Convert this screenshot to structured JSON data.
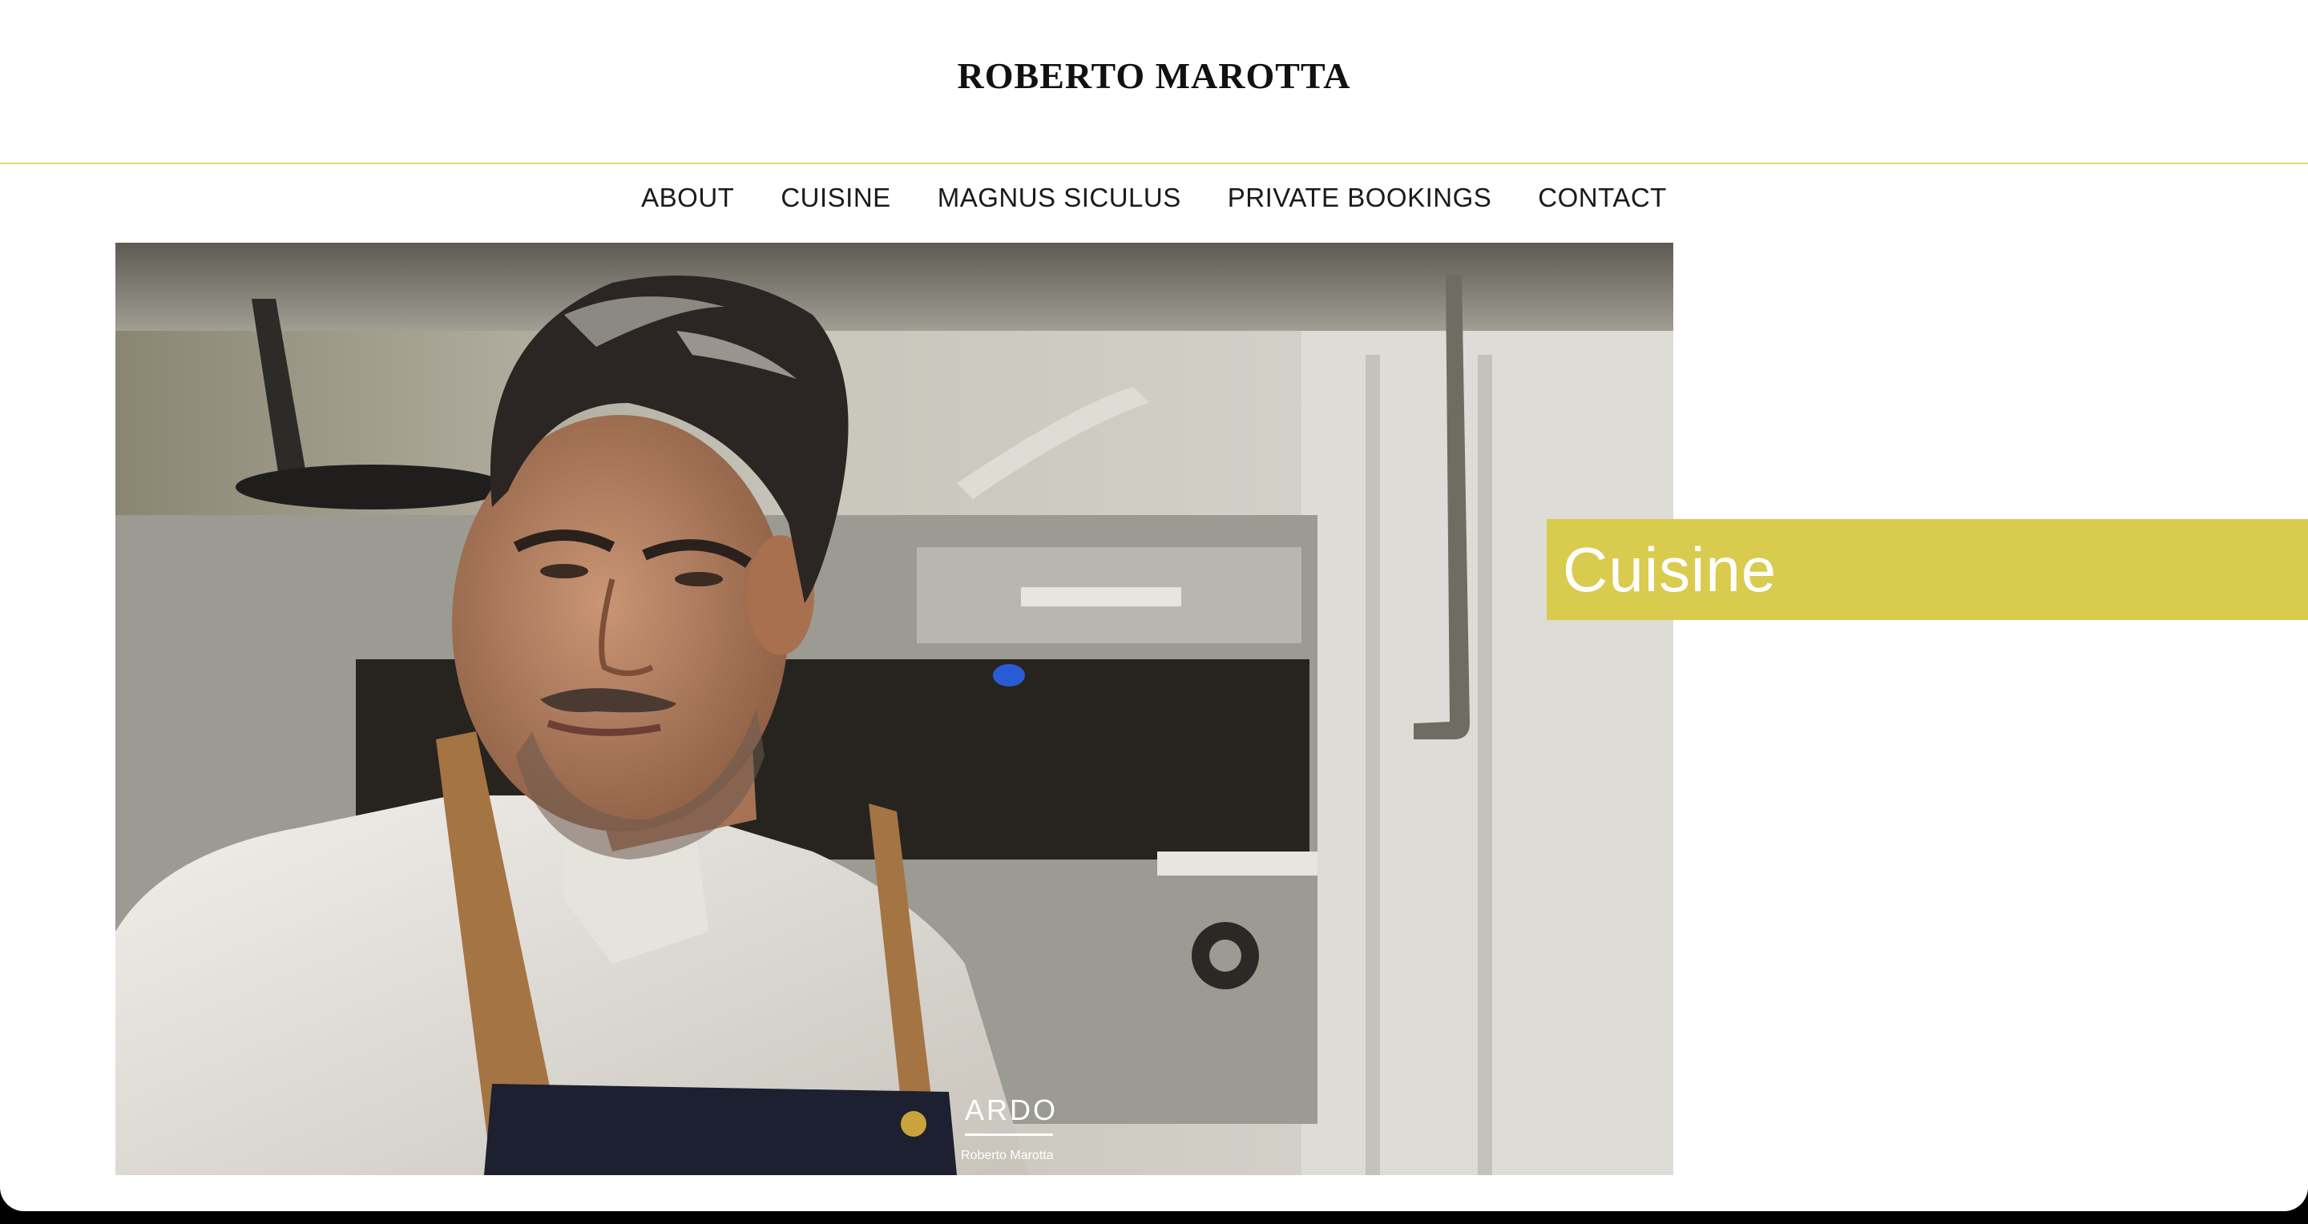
{
  "site": {
    "title": "ROBERTO MAROTTA"
  },
  "nav": {
    "items": [
      {
        "label": "ABOUT"
      },
      {
        "label": "CUISINE"
      },
      {
        "label": "MAGNUS SICULUS"
      },
      {
        "label": "PRIVATE BOOKINGS"
      },
      {
        "label": "CONTACT"
      }
    ]
  },
  "hero": {
    "apron_logo": "ARDO",
    "apron_name": "Roberto Marotta"
  },
  "banner": {
    "label": "Cuisine"
  },
  "colors": {
    "accent": "#d9cb4e",
    "divider": "#e2d774",
    "text": "#1a1a1a",
    "background": "#ffffff"
  }
}
